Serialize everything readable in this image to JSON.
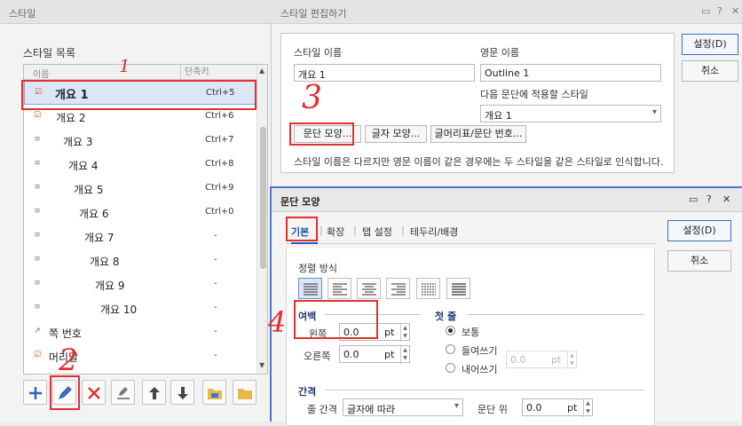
{
  "style_list_window": {
    "title": "스타일",
    "section_label": "스타일 목록",
    "columns": {
      "name": "이름",
      "shortcut": "단축키"
    },
    "items": [
      {
        "name": "개요 1",
        "shortcut": "Ctrl+5",
        "icon": "checked-style-icon"
      },
      {
        "name": "개요 2",
        "shortcut": "Ctrl+6",
        "icon": "checked-style-icon"
      },
      {
        "name": "개요 3",
        "shortcut": "Ctrl+7",
        "icon": "paragraph-style-icon"
      },
      {
        "name": "개요 4",
        "shortcut": "Ctrl+8",
        "icon": "paragraph-style-icon"
      },
      {
        "name": "개요 5",
        "shortcut": "Ctrl+9",
        "icon": "paragraph-style-icon"
      },
      {
        "name": "개요 6",
        "shortcut": "Ctrl+0",
        "icon": "paragraph-style-icon"
      },
      {
        "name": "개요 7",
        "shortcut": "-",
        "icon": "paragraph-style-icon"
      },
      {
        "name": "개요 8",
        "shortcut": "-",
        "icon": "paragraph-style-icon"
      },
      {
        "name": "개요 9",
        "shortcut": "-",
        "icon": "paragraph-style-icon"
      },
      {
        "name": "개요 10",
        "shortcut": "-",
        "icon": "paragraph-style-icon"
      },
      {
        "name": "쪽 번호",
        "shortcut": "-",
        "icon": "char-style-icon"
      },
      {
        "name": "머리말",
        "shortcut": "-",
        "icon": "checked-style-icon"
      }
    ],
    "toolbar": [
      "add-icon",
      "edit-pencil-icon",
      "delete-icon",
      "edit-style-icon",
      "move-up-icon",
      "move-down-icon",
      "open-style-file-icon",
      "folder-icon"
    ]
  },
  "edit_style_window": {
    "title": "스타일 편집하기",
    "style_name_label": "스타일 이름",
    "style_name_value": "개요 1",
    "eng_name_label": "영문 이름",
    "eng_name_value": "Outline 1",
    "next_style_label": "다음 문단에 적용할 스타일",
    "next_style_value": "개요 1",
    "para_shape_button": "문단 모양...",
    "char_shape_button": "글자 모양...",
    "bullet_button": "글머리표/문단 번호...",
    "description": "스타일 이름은 다르지만 영문 이름이 같은 경우에는 두 스타일을 같은 스타일로 인식합니다.",
    "ok_button": "설정(D)",
    "cancel_button": "취소"
  },
  "para_shape_window": {
    "title": "문단 모양",
    "tabs": [
      "기본",
      "확장",
      "탭 설정",
      "테두리/배경"
    ],
    "alignment_label": "정렬 방식",
    "margin_section": "여백",
    "left_label": "왼쪽",
    "left_value": "0.0",
    "right_label": "오른쪽",
    "right_value": "0.0",
    "unit": "pt",
    "first_line_section": "첫 줄",
    "first_line_options": [
      "보통",
      "들여쓰기",
      "내어쓰기"
    ],
    "first_line_value": "0.0",
    "spacing_section": "간격",
    "line_spacing_label": "줄 간격",
    "line_spacing_value": "글자에 따라",
    "para_above_label": "문단 위",
    "para_above_value": "0.0",
    "ok_button": "설정(D)",
    "cancel_button": "취소"
  },
  "annotations": [
    "1",
    "2",
    "3",
    "4"
  ],
  "colors": {
    "annotation_red": "#e03030",
    "accent_blue": "#2d5fc0"
  }
}
